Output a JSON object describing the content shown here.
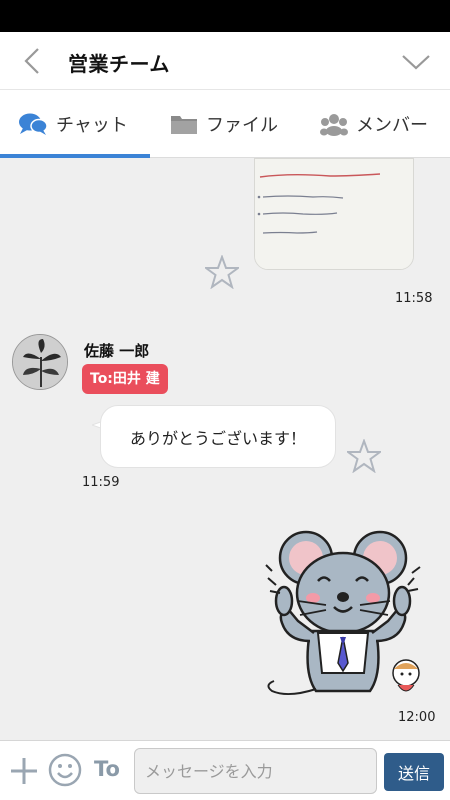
{
  "header": {
    "title": "営業チーム",
    "back_icon": "chevron-left-icon",
    "menu_icon": "chevron-down-icon"
  },
  "tabs": [
    {
      "label": "チャット",
      "icon": "chat-bubbles-icon",
      "active": true
    },
    {
      "label": "ファイル",
      "icon": "folder-icon",
      "active": false
    },
    {
      "label": "メンバー",
      "icon": "paw-group-icon",
      "active": false
    }
  ],
  "colors": {
    "accent": "#3b83d6",
    "mention": "#ea4e5c",
    "send_button": "#2f5c8a"
  },
  "messages": [
    {
      "type": "image",
      "time": "11:58",
      "own": true
    },
    {
      "type": "text",
      "sender": "佐藤 一郎",
      "mention": "To:田井 建",
      "text": "ありがとうございます！",
      "time": "11:59",
      "own": false
    },
    {
      "type": "sticker",
      "time": "12:00",
      "own": true
    }
  ],
  "composer": {
    "to_label": "To",
    "placeholder": "メッセージを入力",
    "send_label": "送信"
  }
}
